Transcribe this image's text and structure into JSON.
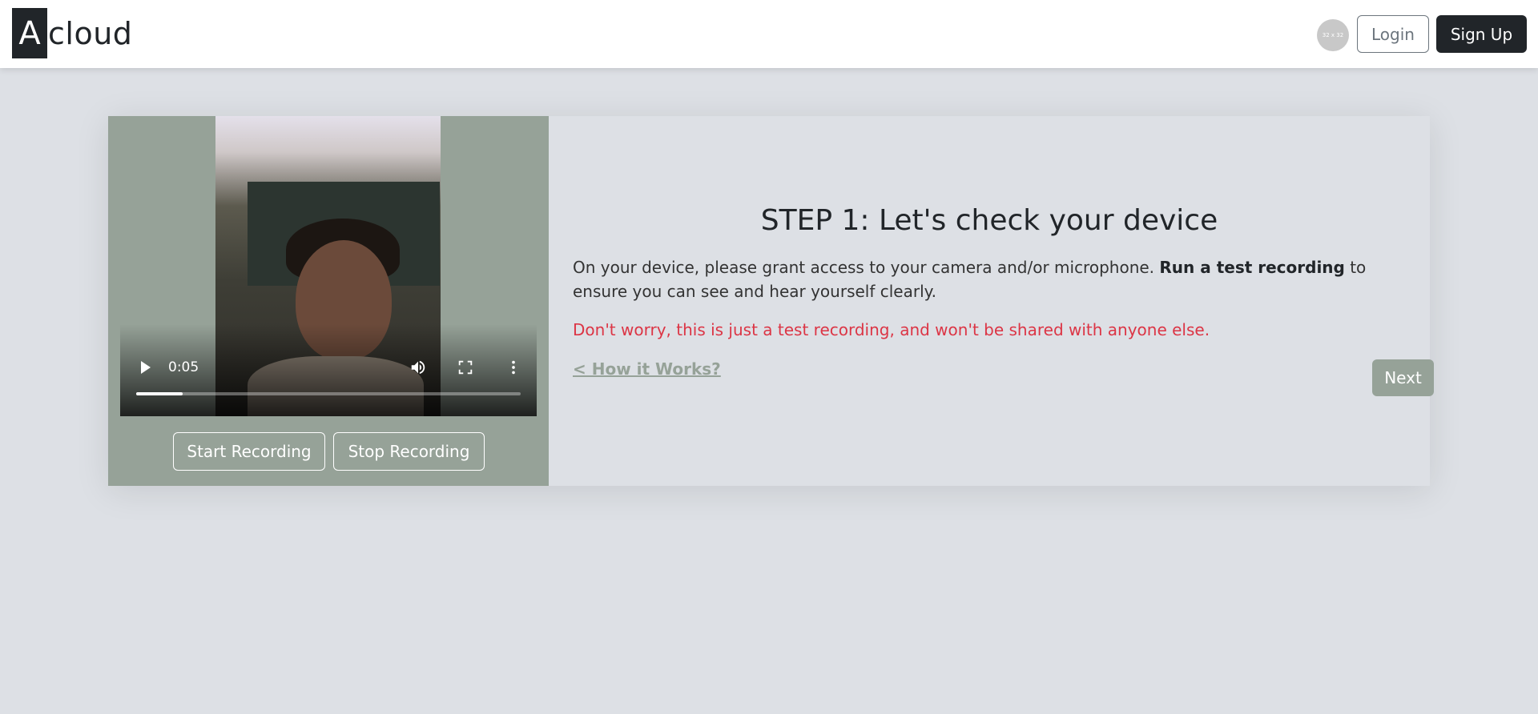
{
  "header": {
    "logo_initial": "A",
    "logo_rest": "cloud",
    "avatar_text": "32 x 32",
    "login_label": "Login",
    "signup_label": "Sign Up"
  },
  "video": {
    "time": "0:05",
    "progress_fraction": 0.12,
    "icons": [
      "play-icon",
      "volume-icon",
      "fullscreen-icon",
      "more-vertical-icon"
    ]
  },
  "recording": {
    "start_label": "Start Recording",
    "stop_label": "Stop Recording"
  },
  "step": {
    "title": "STEP 1: Let's check your device",
    "desc_before": "On your device, please grant access to your camera and/or microphone. ",
    "desc_bold": "Run a test recording",
    "desc_after": " to ensure you can see and hear yourself clearly.",
    "warning": "Don't worry, this is just a test recording, and won't be shared with anyone else.",
    "how_link": "< How it Works?",
    "next_label": "Next"
  },
  "colors": {
    "panel_green": "#96a298",
    "warning_red": "#dc3545",
    "dark": "#212529",
    "background": "#dde0e5"
  }
}
